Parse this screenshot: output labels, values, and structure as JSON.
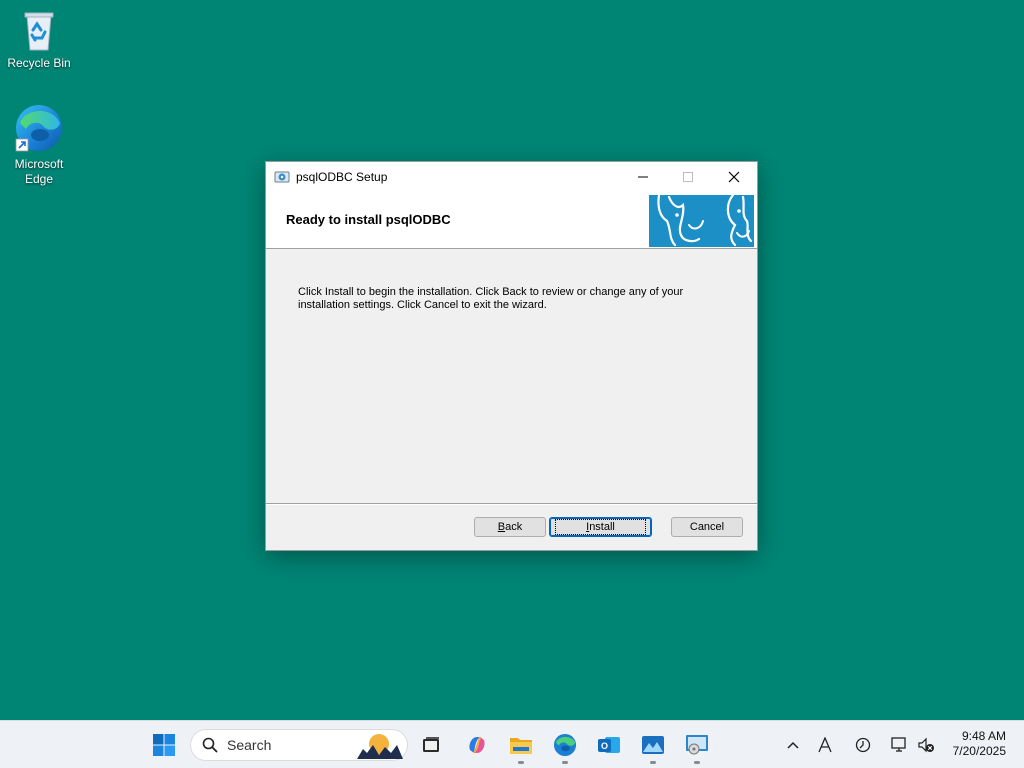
{
  "desktop": {
    "icons": [
      {
        "label": "Recycle Bin"
      },
      {
        "label": "Microsoft Edge"
      }
    ]
  },
  "dialog": {
    "title": "psqlODBC Setup",
    "heading": "Ready to install psqlODBC",
    "body": "Click Install to begin the installation. Click Back to review or change any of your installation settings. Click Cancel to exit the wizard.",
    "buttons": {
      "back": {
        "mnemonic": "B",
        "rest": "ack"
      },
      "install": {
        "mnemonic": "I",
        "rest": "nstall"
      },
      "cancel": "Cancel"
    }
  },
  "taskbar": {
    "search_placeholder": "Search",
    "clock": {
      "time": "9:48 AM",
      "date": "7/20/2025"
    }
  },
  "colors": {
    "desktop": "#008575",
    "banner": "#1c8fc7",
    "accent": "#0067c0"
  }
}
